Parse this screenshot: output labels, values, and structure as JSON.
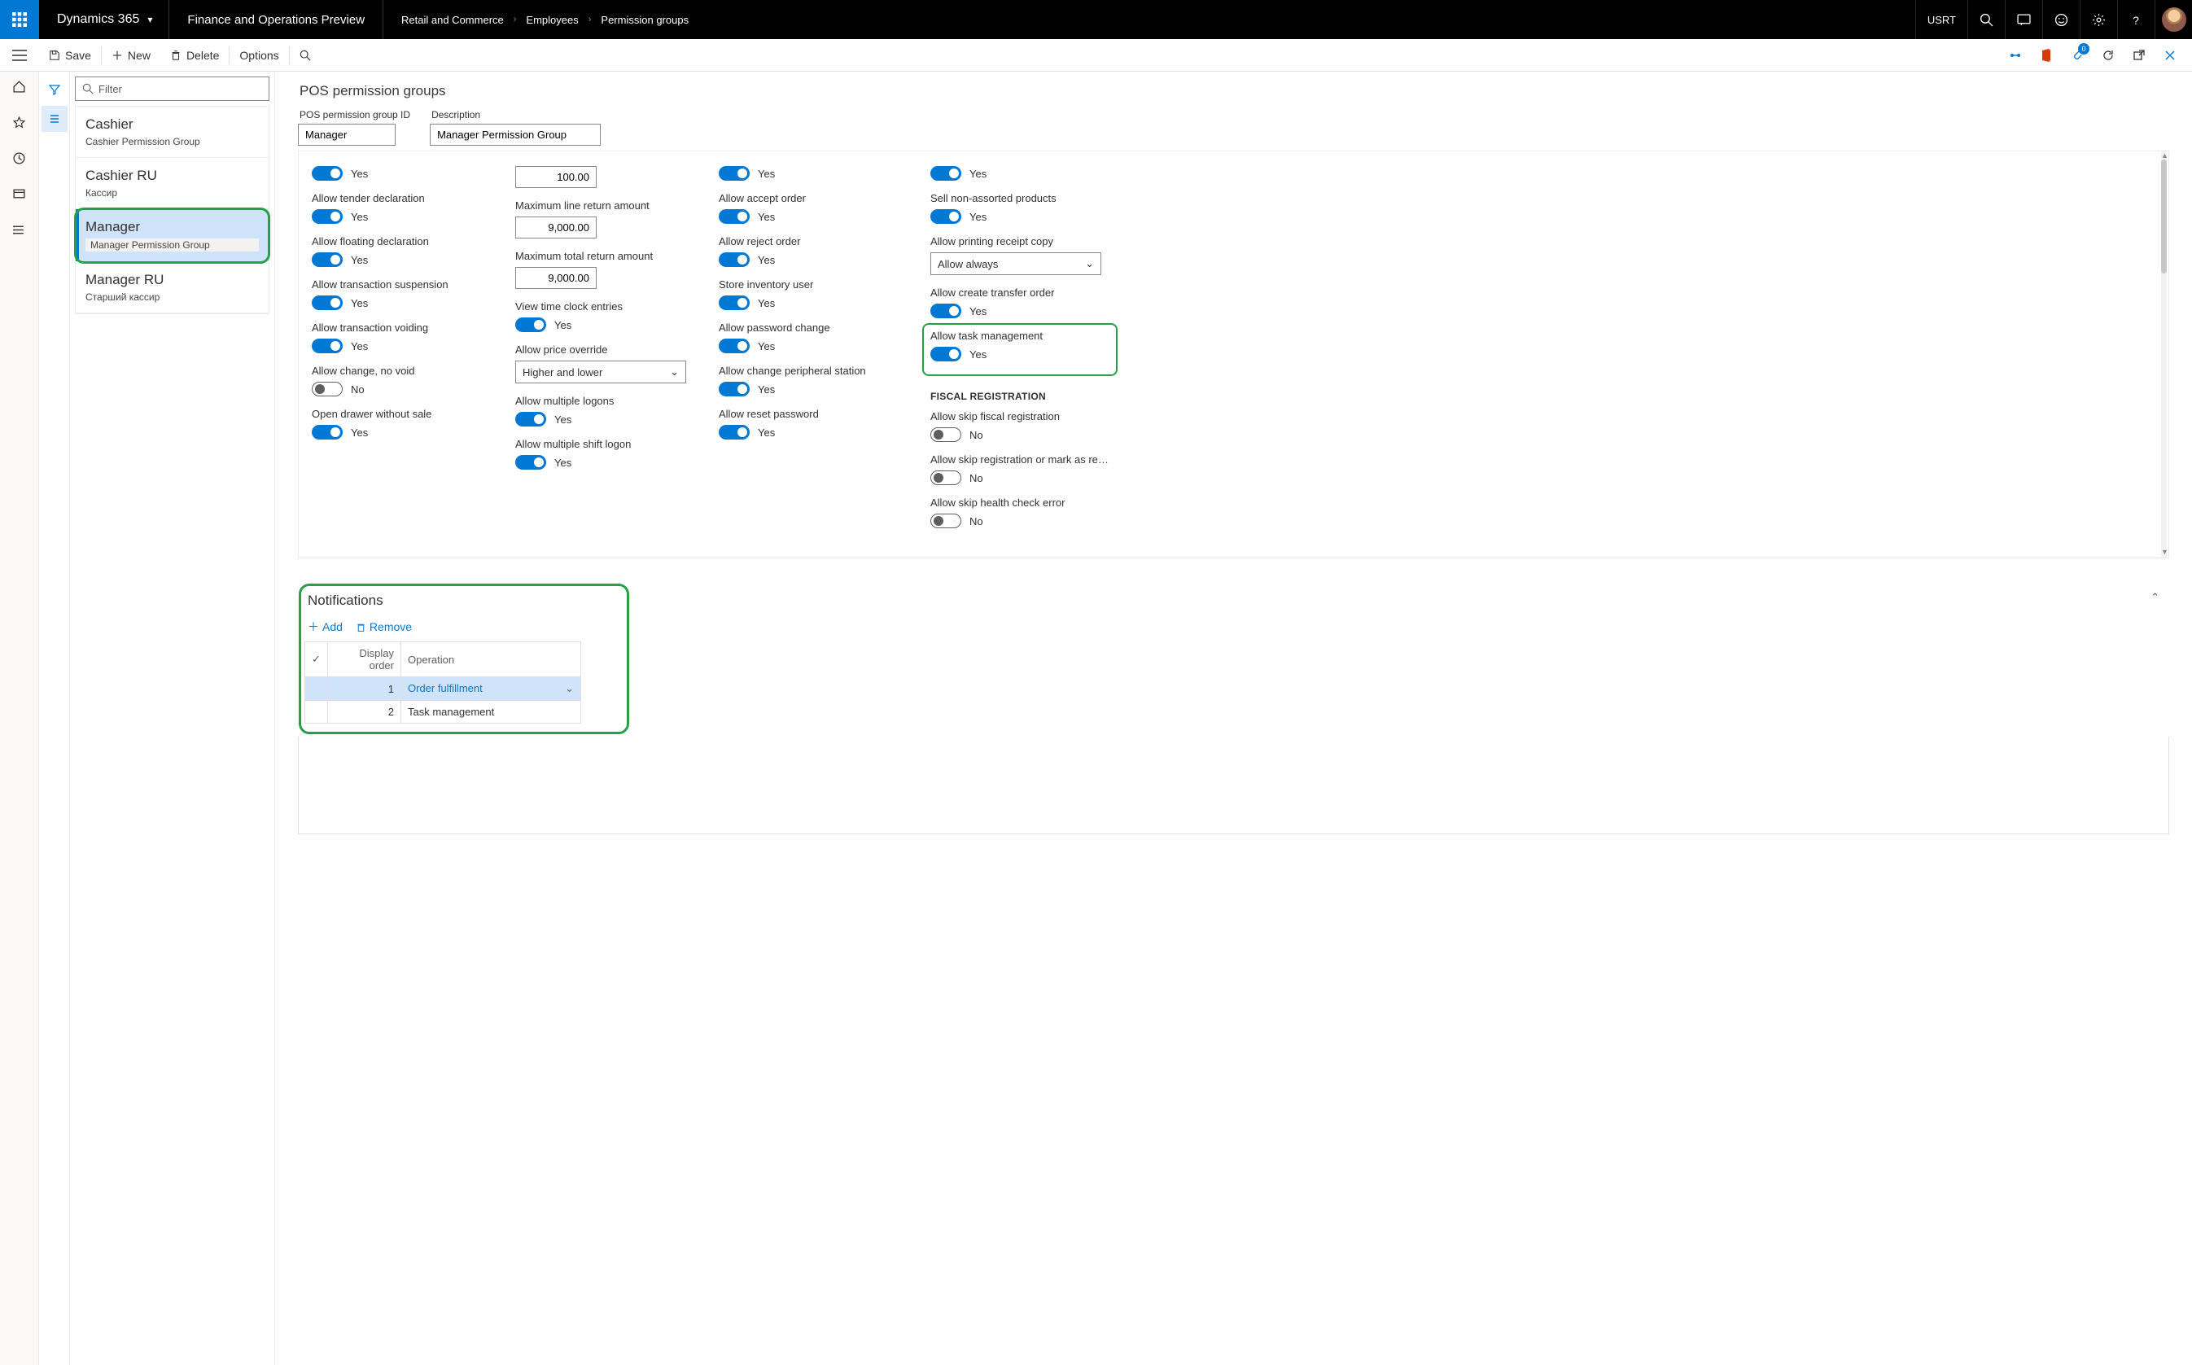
{
  "topbar": {
    "brand": "Dynamics 365",
    "app_title": "Finance and Operations Preview",
    "breadcrumb": [
      "Retail and Commerce",
      "Employees",
      "Permission groups"
    ],
    "user_label": "USRT"
  },
  "actionbar": {
    "save": "Save",
    "new": "New",
    "delete": "Delete",
    "options": "Options"
  },
  "listpane": {
    "filter_placeholder": "Filter",
    "items": [
      {
        "title": "Cashier",
        "subtitle": "Cashier Permission Group"
      },
      {
        "title": "Cashier RU",
        "subtitle": "Кассир"
      },
      {
        "title": "Manager",
        "subtitle": "Manager Permission Group",
        "selected": true
      },
      {
        "title": "Manager RU",
        "subtitle": "Старший кассир"
      }
    ]
  },
  "main": {
    "page_title": "POS permission groups",
    "id_label": "POS permission group ID",
    "desc_label": "Description",
    "id_value": "Manager",
    "desc_value": "Manager Permission Group",
    "yes": "Yes",
    "no": "No",
    "columns": {
      "c1": [
        {
          "label": "",
          "value": "Yes",
          "on": true
        },
        {
          "label": "Allow tender declaration",
          "value": "Yes",
          "on": true
        },
        {
          "label": "Allow floating declaration",
          "value": "Yes",
          "on": true
        },
        {
          "label": "Allow transaction suspension",
          "value": "Yes",
          "on": true
        },
        {
          "label": "Allow transaction voiding",
          "value": "Yes",
          "on": true
        },
        {
          "label": "Allow change, no void",
          "value": "No",
          "on": false
        },
        {
          "label": "Open drawer without sale",
          "value": "Yes",
          "on": true
        }
      ],
      "c2": [
        {
          "label": "",
          "type": "num",
          "value": "100.00"
        },
        {
          "label": "Maximum line return amount",
          "type": "num",
          "value": "9,000.00"
        },
        {
          "label": "Maximum total return amount",
          "type": "num",
          "value": "9,000.00"
        },
        {
          "label": "View time clock entries",
          "value": "Yes",
          "on": true
        },
        {
          "label": "Allow price override",
          "type": "select",
          "value": "Higher and lower"
        },
        {
          "label": "Allow multiple logons",
          "value": "Yes",
          "on": true
        },
        {
          "label": "Allow multiple shift logon",
          "value": "Yes",
          "on": true
        }
      ],
      "c3": [
        {
          "label": "",
          "value": "Yes",
          "on": true
        },
        {
          "label": "Allow accept order",
          "value": "Yes",
          "on": true
        },
        {
          "label": "Allow reject order",
          "value": "Yes",
          "on": true
        },
        {
          "label": "Store inventory user",
          "value": "Yes",
          "on": true
        },
        {
          "label": "Allow password change",
          "value": "Yes",
          "on": true
        },
        {
          "label": "Allow change peripheral station",
          "value": "Yes",
          "on": true
        },
        {
          "label": "Allow reset password",
          "value": "Yes",
          "on": true
        }
      ],
      "c4": [
        {
          "label": "",
          "value": "Yes",
          "on": true
        },
        {
          "label": "Sell non-assorted products",
          "value": "Yes",
          "on": true
        },
        {
          "label": "Allow printing receipt copy",
          "type": "select",
          "value": "Allow always"
        },
        {
          "label": "Allow create transfer order",
          "value": "Yes",
          "on": true
        },
        {
          "label": "Allow task management",
          "value": "Yes",
          "on": true,
          "highlight": true
        }
      ],
      "fiscal_header": "FISCAL REGISTRATION",
      "fiscal": [
        {
          "label": "Allow skip fiscal registration",
          "value": "No",
          "on": false
        },
        {
          "label": "Allow skip registration or mark as re…",
          "value": "No",
          "on": false
        },
        {
          "label": "Allow skip health check error",
          "value": "No",
          "on": false
        }
      ]
    },
    "notifications": {
      "title": "Notifications",
      "add": "Add",
      "remove": "Remove",
      "cols": {
        "check": "✓",
        "display_order": "Display order",
        "operation": "Operation"
      },
      "rows": [
        {
          "order": "1",
          "operation": "Order fulfillment",
          "selected": true
        },
        {
          "order": "2",
          "operation": "Task management"
        }
      ]
    }
  }
}
